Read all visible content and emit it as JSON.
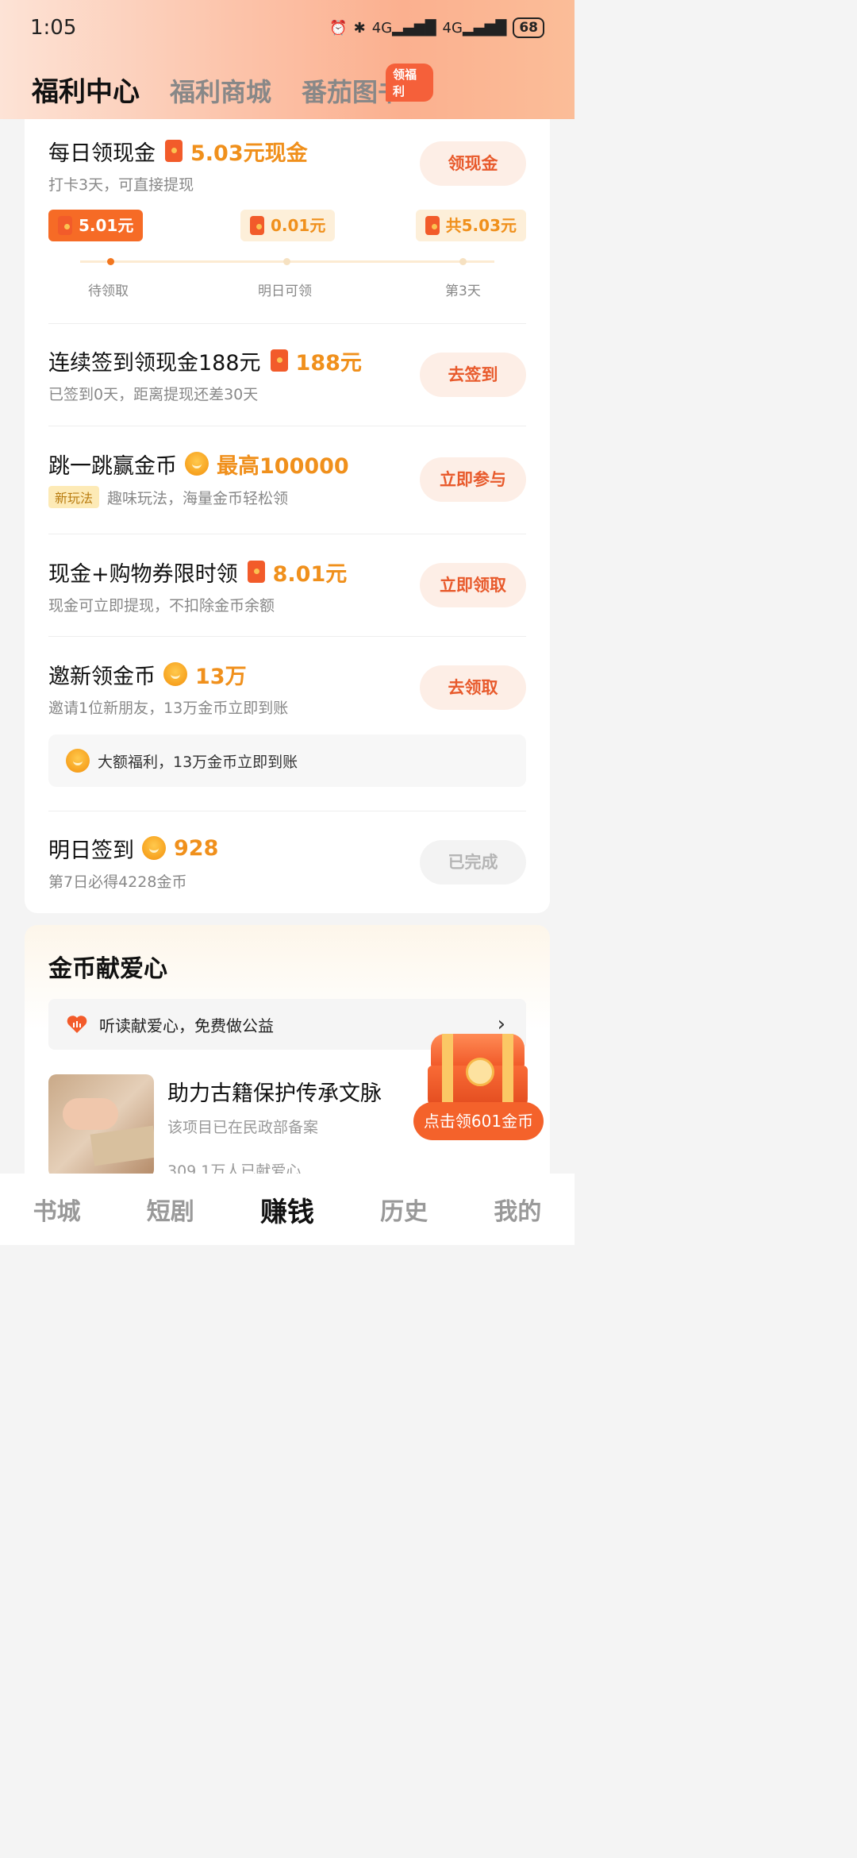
{
  "status": {
    "time": "1:05",
    "battery": "68",
    "net1": "4G",
    "net2": "4G"
  },
  "tabs": [
    {
      "label": "福利中心"
    },
    {
      "label": "福利商城"
    },
    {
      "label": "番茄图书"
    }
  ],
  "tab_badge": "领福利",
  "daily_cash": {
    "title": "每日领现金",
    "reward": "5.03元现金",
    "sub": "打卡3天，可直接提现",
    "button": "领现金",
    "steps": [
      {
        "amount": "5.01元",
        "label": "待领取"
      },
      {
        "amount": "0.01元",
        "label": "明日可领"
      },
      {
        "amount": "共5.03元",
        "label": "第3天"
      }
    ]
  },
  "signin": {
    "title": "连续签到领现金188元",
    "reward": "188元",
    "sub": "已签到0天，距离提现还差30天",
    "button": "去签到"
  },
  "jump": {
    "title": "跳一跳赢金币",
    "reward": "最高100000",
    "tag": "新玩法",
    "sub": "趣味玩法，海量金币轻松领",
    "button": "立即参与"
  },
  "voucher": {
    "title": "现金+购物券限时领",
    "reward": "8.01元",
    "sub": "现金可立即提现，不扣除金币余额",
    "button": "立即领取"
  },
  "invite": {
    "title": "邀新领金币",
    "reward": "13万",
    "sub": "邀请1位新朋友，13万金币立即到账",
    "button": "去领取",
    "strip": "大额福利，13万金币立即到账"
  },
  "tomorrow": {
    "title": "明日签到",
    "reward": "928",
    "sub": "第7日必得4228金币",
    "button": "已完成"
  },
  "charity": {
    "heading": "金币献爱心",
    "strip": "听读献爱心，免费做公益",
    "project_title": "助力古籍保护传承文脉",
    "project_sub": "该项目已在民政部备案",
    "project_count": "309.1万人已献爱心"
  },
  "chest_claim": "点击领601金币",
  "bottom_nav": [
    {
      "label": "书城"
    },
    {
      "label": "短剧"
    },
    {
      "label": "赚钱"
    },
    {
      "label": "历史"
    },
    {
      "label": "我的"
    }
  ],
  "colors": {
    "accent": "#f66b26",
    "reward": "#f0901c"
  }
}
